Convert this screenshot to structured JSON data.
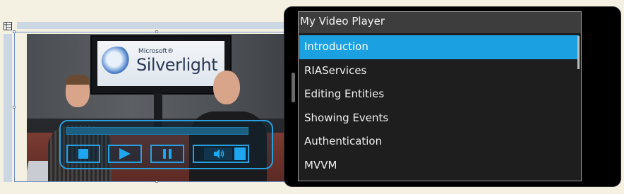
{
  "player": {
    "title": "My Video Player",
    "video": {
      "logo_small": "Microsoft®",
      "logo_big": "Silverlight"
    },
    "playlist": [
      {
        "label": "Introduction",
        "selected": true
      },
      {
        "label": "RIAServices",
        "selected": false
      },
      {
        "label": "Editing Entities",
        "selected": false
      },
      {
        "label": "Showing Events",
        "selected": false
      },
      {
        "label": "Authentication",
        "selected": false
      },
      {
        "label": "MVVM",
        "selected": false
      }
    ],
    "controls": {
      "stop_icon": "stop-icon",
      "play_icon": "play-icon",
      "pause_icon": "pause-icon",
      "volume_icon": "volume-icon"
    }
  },
  "colors": {
    "accent": "#1ba1e2",
    "control_stroke": "#28a0e0",
    "designer_background": "#f4f1e2",
    "selection_outline": "#6f8dc9"
  }
}
